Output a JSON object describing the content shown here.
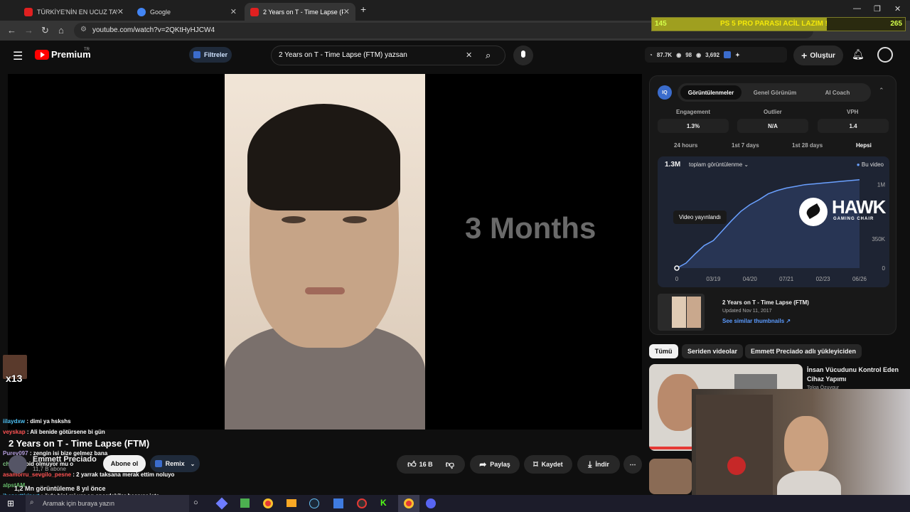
{
  "browser": {
    "tabs": [
      {
        "label": "TÜRKİYE'NİN EN UCUZ TAVUK",
        "favicon": "youtube-icon",
        "active": false
      },
      {
        "label": "Google",
        "favicon": "google-icon",
        "active": false
      },
      {
        "label": "2 Years on T - Time Lapse (FTM",
        "favicon": "youtube-icon",
        "active": true
      }
    ],
    "new_tab": "+",
    "url": "youtube.com/watch?v=2QKtHyHJCW4"
  },
  "overlay_goal": {
    "left_count": "145",
    "text": "PS 5 PRO PARASI ACİL LAZIM !",
    "right_count": "265",
    "progress": 0.69
  },
  "header": {
    "logo": "Premium",
    "region": "TR",
    "filters": "Filtreler",
    "search_query": "2 Years on T - Time Lapse (FTM) yazsan",
    "stats": {
      "views": "87.7K",
      "eye": "98",
      "watch": "3,692"
    },
    "create": "Oluştur"
  },
  "player": {
    "overlay_text": "3 Months"
  },
  "chat": [
    {
      "user": "iilaydxw",
      "msg": " : dimi ya hskshs",
      "user_color": "#4fc3f7"
    },
    {
      "user": "veyskap",
      "msg": " : Ali benide götürsene bi gün",
      "user_color": "#ff5252"
    },
    {
      "user": "Purev097",
      "msg": " : zengin isi bize gelmez bana",
      "user_color": "#b39ddb"
    },
    {
      "user": "ch",
      "msg": " : Steroid olmuyor mu o",
      "user_color": "#81c784"
    },
    {
      "user": "asamorru_sevgilo_pesne",
      "msg": " : 2 yarrak taksana merak ettim noluyo",
      "user_color": "#ff5252"
    },
    {
      "user": "alpstAM",
      "msg": "",
      "user_color": "#66bb6a"
    },
    {
      "user": "ibozorttirizort",
      "msg": " : öyle bişi mi var ag spordakiler basıyor işte",
      "user_color": "#4fc3f7"
    }
  ],
  "sub_badge": "x13",
  "video": {
    "title": "2 Years on T - Time Lapse (FTM)",
    "channel": "Emmett Preciado",
    "subs": "11,7 B abone",
    "subscribe": "Abone ol",
    "remix": "Remix",
    "likes": "16 B",
    "share": "Paylaş",
    "save": "Kaydet",
    "download": "İndir",
    "meta": "1,2 Mn görüntüleme  8 yıl önce"
  },
  "vidiq": {
    "tabs": [
      "Görüntülenmeler",
      "Genel Görünüm",
      "AI Coach"
    ],
    "metrics": [
      {
        "label": "Engagement",
        "value": "1.3%"
      },
      {
        "label": "Outlier",
        "value": "N/A"
      },
      {
        "label": "VPH",
        "value": "1.4"
      }
    ],
    "ranges": [
      "24 hours",
      "1st 7 days",
      "1st 28 days",
      "Hepsi"
    ],
    "total": "1.3M",
    "total_label": "toplam görüntülenme",
    "legend": "Bu video",
    "tooltip": "Video yayınlandı",
    "brand": "HAWK",
    "brand_sub": "GAMING CHAIR",
    "thumb_title": "2 Years on T - Time Lapse (FTM)",
    "thumb_date": "Updated Nov 11, 2017",
    "thumb_link": "See similar thumbnails ↗"
  },
  "chart_data": {
    "type": "line",
    "x_ticks": [
      "0",
      "03/19",
      "04/20",
      "07/21",
      "02/23",
      "06/26"
    ],
    "y_ticks": [
      "0",
      "350K",
      "1M"
    ],
    "series": [
      {
        "name": "Bu video",
        "values": [
          0,
          60,
          170,
          270,
          330,
          450,
          570,
          680,
          760,
          820,
          890,
          930,
          960,
          980,
          1000,
          1010,
          1020,
          1030,
          1040,
          1050,
          1060
        ]
      }
    ],
    "ylim": [
      0,
      1100
    ]
  },
  "chips": [
    "Tümü",
    "Seriden videolar",
    "Emmett Preciado adlı yükleyiciden"
  ],
  "recommended": {
    "title": "İnsan Vücudunu Kontrol Eden Cihaz Yapımı",
    "channel": "Tolga Özuygur"
  },
  "taskbar": {
    "search_placeholder": "Aramak için buraya yazın"
  }
}
